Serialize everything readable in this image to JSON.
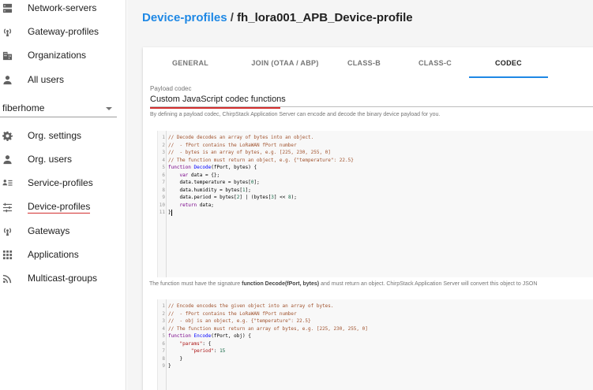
{
  "sidebar": {
    "top_items": [
      {
        "label": "Network-servers",
        "icon": "server-icon"
      },
      {
        "label": "Gateway-profiles",
        "icon": "radio-tower-icon"
      },
      {
        "label": "Organizations",
        "icon": "building-icon"
      },
      {
        "label": "All users",
        "icon": "person-icon"
      }
    ],
    "org_select": {
      "value": "fiberhome"
    },
    "org_items": [
      {
        "label": "Org. settings",
        "icon": "gear-icon"
      },
      {
        "label": "Org. users",
        "icon": "person-icon"
      },
      {
        "label": "Service-profiles",
        "icon": "account-list-icon"
      },
      {
        "label": "Device-profiles",
        "icon": "tune-icon"
      },
      {
        "label": "Gateways",
        "icon": "radio-tower-icon"
      },
      {
        "label": "Applications",
        "icon": "grid-icon"
      },
      {
        "label": "Multicast-groups",
        "icon": "rss-icon"
      }
    ]
  },
  "breadcrumb": {
    "link": "Device-profiles",
    "separator": "/",
    "current": "fh_lora001_APB_Device-profile"
  },
  "tabs": [
    {
      "label": "GENERAL",
      "active": false
    },
    {
      "label": "JOIN (OTAA / ABP)",
      "active": false
    },
    {
      "label": "CLASS-B",
      "active": false
    },
    {
      "label": "CLASS-C",
      "active": false
    },
    {
      "label": "CODEC",
      "active": true
    }
  ],
  "codec": {
    "field_label": "Payload codec",
    "value": "Custom JavaScript codec functions",
    "helper": "By defining a payload codec, ChirpStack Application Server can encode and decode the binary device payload for you."
  },
  "decode_code": {
    "lines": [
      "// Decode decodes an array of bytes into an object.",
      "//  - fPort contains the LoRaWAN fPort number",
      "//  - bytes is an array of bytes, e.g. [225, 230, 255, 0]",
      "// The function must return an object, e.g. {\"temperature\": 22.5}",
      "function Decode(fPort, bytes) {",
      "    var data = {};",
      "    data.temperature = bytes[0];",
      "    data.humidity = bytes[1];",
      "    data.period = bytes[2] | (bytes[3] << 8);",
      "    return data;",
      "}"
    ]
  },
  "signature_text": {
    "before": "The function must have the signature ",
    "bold": "function Decode(fPort, bytes)",
    "after": " and must return an object. ChirpStack Application Server will convert this object to JSON"
  },
  "encode_code": {
    "lines": [
      "// Encode encodes the given object into an array of bytes.",
      "//  - fPort contains the LoRaWAN fPort number",
      "//  - obj is an object, e.g. {\"temperature\": 22.5}",
      "// The function must return an array of bytes, e.g. [225, 230, 255, 0]",
      "function Encode(fPort, obj) {",
      "    \"params\": {",
      "        \"period\": 15",
      "    }",
      "}"
    ]
  },
  "colors": {
    "accent": "#1e88e5",
    "annotation_red": "#d32f2f",
    "main_bg": "#f5f5f5"
  }
}
